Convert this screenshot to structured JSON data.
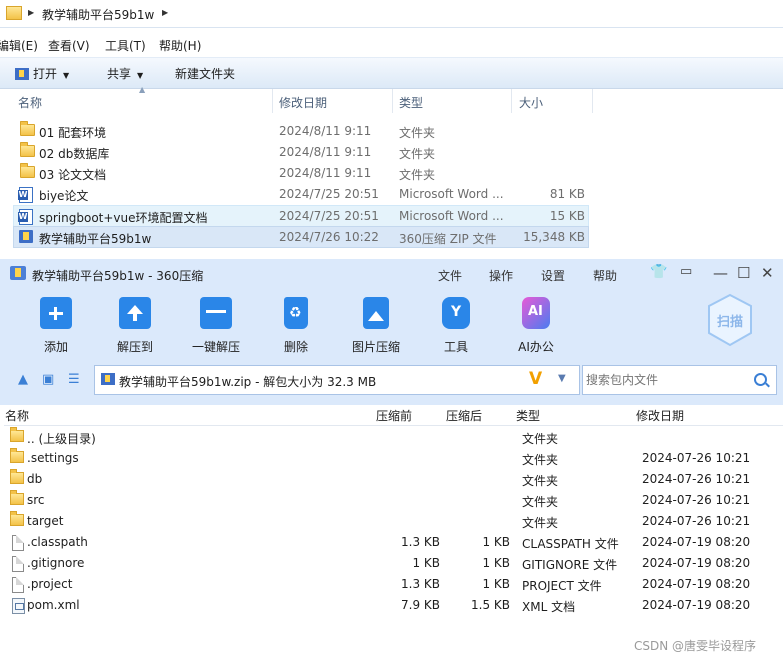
{
  "explorer": {
    "breadcrumb": "教学辅助平台59b1w",
    "menu": [
      "编辑(E)",
      "查看(V)",
      "工具(T)",
      "帮助(H)"
    ],
    "toolbar": {
      "open": "打开",
      "share": "共享",
      "new_folder": "新建文件夹"
    },
    "columns": {
      "name": "名称",
      "date": "修改日期",
      "type": "类型",
      "size": "大小"
    },
    "files": [
      {
        "name": "01 配套环境",
        "date": "2024/8/11 9:11",
        "type": "文件夹",
        "size": ""
      },
      {
        "name": "02 db数据库",
        "date": "2024/8/11 9:11",
        "type": "文件夹",
        "size": ""
      },
      {
        "name": "03 论文文档",
        "date": "2024/8/11 9:11",
        "type": "文件夹",
        "size": ""
      },
      {
        "name": "biye论文",
        "date": "2024/7/25 20:51",
        "type": "Microsoft Word ...",
        "size": "81 KB"
      },
      {
        "name": "springboot+vue环境配置文档",
        "date": "2024/7/25 20:51",
        "type": "Microsoft Word ...",
        "size": "15 KB"
      },
      {
        "name": "教学辅助平台59b1w",
        "date": "2024/7/26 10:22",
        "type": "360压缩 ZIP 文件",
        "size": "15,348 KB"
      }
    ]
  },
  "zip": {
    "title": "教学辅助平台59b1w - 360压缩",
    "menu": [
      "文件",
      "操作",
      "设置",
      "帮助"
    ],
    "tools": [
      "添加",
      "解压到",
      "一键解压",
      "删除",
      "图片压缩",
      "工具",
      "AI办公"
    ],
    "scan_label": "扫描",
    "path": "教学辅助平台59b1w.zip - 解包大小为 32.3 MB",
    "search_placeholder": "搜索包内文件",
    "columns": {
      "name": "名称",
      "before": "压缩前",
      "after": "压缩后",
      "type": "类型",
      "date": "修改日期"
    },
    "rows": [
      {
        "name": ".. (上级目录)",
        "before": "",
        "after": "",
        "type": "文件夹",
        "date": ""
      },
      {
        "name": ".settings",
        "before": "",
        "after": "",
        "type": "文件夹",
        "date": "2024-07-26 10:21"
      },
      {
        "name": "db",
        "before": "",
        "after": "",
        "type": "文件夹",
        "date": "2024-07-26 10:21"
      },
      {
        "name": "src",
        "before": "",
        "after": "",
        "type": "文件夹",
        "date": "2024-07-26 10:21"
      },
      {
        "name": "target",
        "before": "",
        "after": "",
        "type": "文件夹",
        "date": "2024-07-26 10:21"
      },
      {
        "name": ".classpath",
        "before": "1.3 KB",
        "after": "1 KB",
        "type": "CLASSPATH 文件",
        "date": "2024-07-19 08:20"
      },
      {
        "name": ".gitignore",
        "before": "1 KB",
        "after": "1 KB",
        "type": "GITIGNORE 文件",
        "date": "2024-07-19 08:20"
      },
      {
        "name": ".project",
        "before": "1.3 KB",
        "after": "1 KB",
        "type": "PROJECT 文件",
        "date": "2024-07-19 08:20"
      },
      {
        "name": "pom.xml",
        "before": "7.9 KB",
        "after": "1.5 KB",
        "type": "XML 文档",
        "date": "2024-07-19 08:20"
      }
    ]
  },
  "watermark": "CSDN @唐雯毕设程序"
}
